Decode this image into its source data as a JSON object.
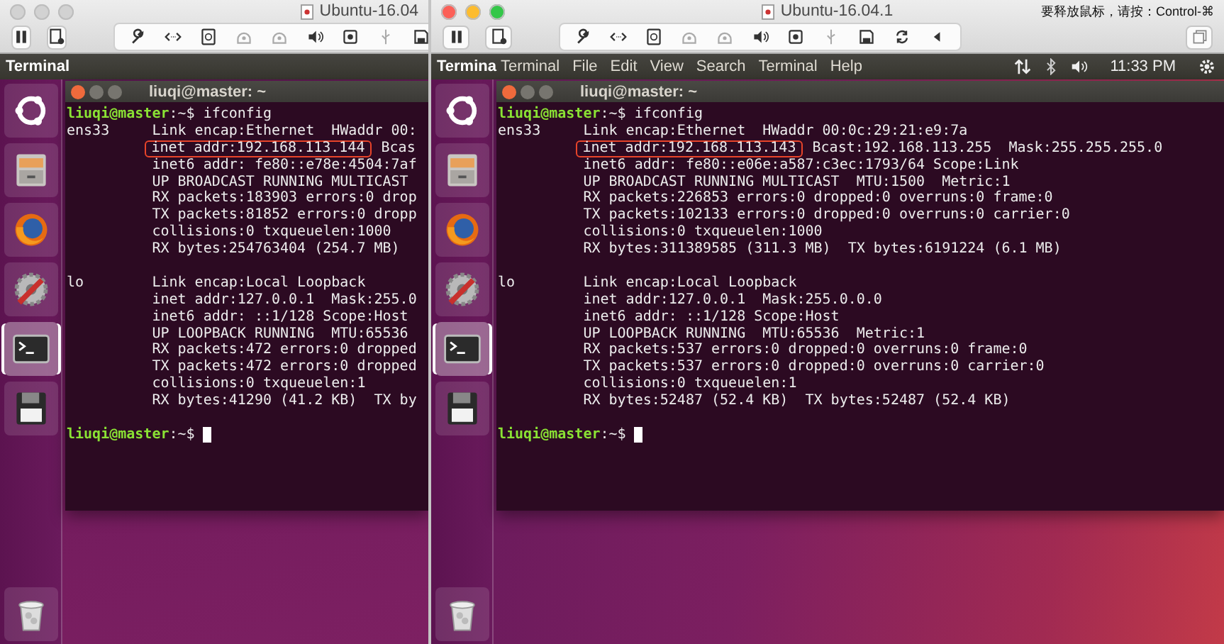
{
  "windows": [
    {
      "title": "Ubuntu-16.04",
      "active": false,
      "panel": {
        "app_name": "Terminal"
      },
      "launcher": [
        {
          "selected": false
        },
        {
          "selected": false
        },
        {
          "selected": false
        },
        {
          "selected": false
        },
        {
          "selected": true
        },
        {
          "selected": false
        },
        {
          "selected": false
        }
      ],
      "terminal": {
        "title": "liuqi@master: ~",
        "lines": [
          {
            "kind": "prompt",
            "user": "liuqi@master",
            "path": ":~$",
            "command": " ifconfig",
            "cursor": false
          },
          {
            "kind": "output",
            "label": "ens33",
            "segments": [
              {
                "text": "Link encap:Ethernet  HWaddr 00:",
                "highlighted": false
              }
            ]
          },
          {
            "kind": "output",
            "segments": [
              {
                "text": "inet addr:192.168.113.144",
                "highlighted": true
              },
              {
                "text": "  Bcas",
                "highlighted": false
              }
            ]
          },
          {
            "kind": "output",
            "segments": [
              {
                "text": "inet6 addr: fe80::e78e:4504:7af",
                "highlighted": false
              }
            ]
          },
          {
            "kind": "output",
            "segments": [
              {
                "text": "UP BROADCAST RUNNING MULTICAST",
                "highlighted": false
              }
            ]
          },
          {
            "kind": "output",
            "segments": [
              {
                "text": "RX packets:183903 errors:0 drop",
                "highlighted": false
              }
            ]
          },
          {
            "kind": "output",
            "segments": [
              {
                "text": "TX packets:81852 errors:0 dropp",
                "highlighted": false
              }
            ]
          },
          {
            "kind": "output",
            "segments": [
              {
                "text": "collisions:0 txqueuelen:1000",
                "highlighted": false
              }
            ]
          },
          {
            "kind": "output",
            "segments": [
              {
                "text": "RX bytes:254763404 (254.7 MB)",
                "highlighted": false
              }
            ]
          },
          {
            "kind": "blank"
          },
          {
            "kind": "output",
            "label": "lo",
            "segments": [
              {
                "text": "Link encap:Local Loopback",
                "highlighted": false
              }
            ]
          },
          {
            "kind": "output",
            "segments": [
              {
                "text": "inet addr:127.0.0.1  Mask:255.0",
                "highlighted": false
              }
            ]
          },
          {
            "kind": "output",
            "segments": [
              {
                "text": "inet6 addr: ::1/128 Scope:Host",
                "highlighted": false
              }
            ]
          },
          {
            "kind": "output",
            "segments": [
              {
                "text": "UP LOOPBACK RUNNING  MTU:65536",
                "highlighted": false
              }
            ]
          },
          {
            "kind": "output",
            "segments": [
              {
                "text": "RX packets:472 errors:0 dropped",
                "highlighted": false
              }
            ]
          },
          {
            "kind": "output",
            "segments": [
              {
                "text": "TX packets:472 errors:0 dropped",
                "highlighted": false
              }
            ]
          },
          {
            "kind": "output",
            "segments": [
              {
                "text": "collisions:0 txqueuelen:1",
                "highlighted": false
              }
            ]
          },
          {
            "kind": "output",
            "segments": [
              {
                "text": "RX bytes:41290 (41.2 KB)  TX by",
                "highlighted": false
              }
            ]
          },
          {
            "kind": "blank"
          },
          {
            "kind": "prompt",
            "user": "liuqi@master",
            "path": ":~$",
            "cursor": true
          }
        ]
      }
    },
    {
      "title": "Ubuntu-16.04.1",
      "active": true,
      "hint": "要释放鼠标，请按：Control-⌘",
      "panel": {
        "app_name": "Termina",
        "menu": [
          "Terminal",
          "File",
          "Edit",
          "View",
          "Search",
          "Terminal",
          "Help"
        ],
        "clock": "11:33 PM"
      },
      "launcher": [
        {
          "selected": false
        },
        {
          "selected": false
        },
        {
          "selected": false
        },
        {
          "selected": false
        },
        {
          "selected": true
        },
        {
          "selected": false
        },
        {
          "selected": false
        }
      ],
      "terminal": {
        "title": "liuqi@master: ~",
        "lines": [
          {
            "kind": "prompt",
            "user": "liuqi@master",
            "path": ":~$",
            "command": " ifconfig",
            "cursor": false
          },
          {
            "kind": "output",
            "label": "ens33",
            "segments": [
              {
                "text": "Link encap:Ethernet  HWaddr 00:0c:29:21:e9:7a",
                "highlighted": false
              }
            ]
          },
          {
            "kind": "output",
            "segments": [
              {
                "text": "inet addr:192.168.113.143",
                "highlighted": true
              },
              {
                "text": "  Bcast:192.168.113.255  Mask:255.255.255.0",
                "highlighted": false
              }
            ]
          },
          {
            "kind": "output",
            "segments": [
              {
                "text": "inet6 addr: fe80::e06e:a587:c3ec:1793/64 Scope:Link",
                "highlighted": false
              }
            ]
          },
          {
            "kind": "output",
            "segments": [
              {
                "text": "UP BROADCAST RUNNING MULTICAST  MTU:1500  Metric:1",
                "highlighted": false
              }
            ]
          },
          {
            "kind": "output",
            "segments": [
              {
                "text": "RX packets:226853 errors:0 dropped:0 overruns:0 frame:0",
                "highlighted": false
              }
            ]
          },
          {
            "kind": "output",
            "segments": [
              {
                "text": "TX packets:102133 errors:0 dropped:0 overruns:0 carrier:0",
                "highlighted": false
              }
            ]
          },
          {
            "kind": "output",
            "segments": [
              {
                "text": "collisions:0 txqueuelen:1000",
                "highlighted": false
              }
            ]
          },
          {
            "kind": "output",
            "segments": [
              {
                "text": "RX bytes:311389585 (311.3 MB)  TX bytes:6191224 (6.1 MB)",
                "highlighted": false
              }
            ]
          },
          {
            "kind": "blank"
          },
          {
            "kind": "output",
            "label": "lo",
            "segments": [
              {
                "text": "Link encap:Local Loopback",
                "highlighted": false
              }
            ]
          },
          {
            "kind": "output",
            "segments": [
              {
                "text": "inet addr:127.0.0.1  Mask:255.0.0.0",
                "highlighted": false
              }
            ]
          },
          {
            "kind": "output",
            "segments": [
              {
                "text": "inet6 addr: ::1/128 Scope:Host",
                "highlighted": false
              }
            ]
          },
          {
            "kind": "output",
            "segments": [
              {
                "text": "UP LOOPBACK RUNNING  MTU:65536  Metric:1",
                "highlighted": false
              }
            ]
          },
          {
            "kind": "output",
            "segments": [
              {
                "text": "RX packets:537 errors:0 dropped:0 overruns:0 frame:0",
                "highlighted": false
              }
            ]
          },
          {
            "kind": "output",
            "segments": [
              {
                "text": "TX packets:537 errors:0 dropped:0 overruns:0 carrier:0",
                "highlighted": false
              }
            ]
          },
          {
            "kind": "output",
            "segments": [
              {
                "text": "collisions:0 txqueuelen:1",
                "highlighted": false
              }
            ]
          },
          {
            "kind": "output",
            "segments": [
              {
                "text": "RX bytes:52487 (52.4 KB)  TX bytes:52487 (52.4 KB)",
                "highlighted": false
              }
            ]
          },
          {
            "kind": "blank"
          },
          {
            "kind": "prompt",
            "user": "liuqi@master",
            "path": ":~$",
            "cursor": true
          }
        ]
      }
    }
  ]
}
